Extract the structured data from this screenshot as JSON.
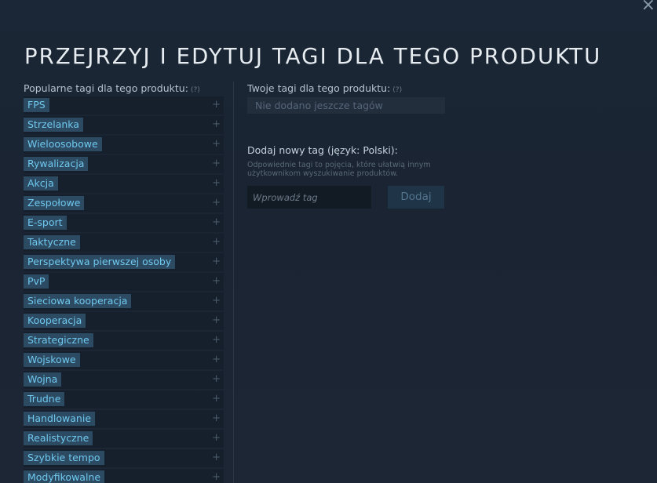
{
  "dialog": {
    "title": "PRZEJRZYJ I EDYTUJ TAGI DLA TEGO PRODUKTU",
    "close_glyph": "×"
  },
  "popular": {
    "heading": "Popularne tagi dla tego produktu:",
    "help": "(?)",
    "plus_glyph": "+",
    "tags": [
      "FPS",
      "Strzelanka",
      "Wieloosobowe",
      "Rywalizacja",
      "Akcja",
      "Zespołowe",
      "E-sport",
      "Taktyczne",
      "Perspektywa pierwszej osoby",
      "PvP",
      "Sieciowa kooperacja",
      "Kooperacja",
      "Strategiczne",
      "Wojskowe",
      "Wojna",
      "Trudne",
      "Handlowanie",
      "Realistyczne",
      "Szybkie tempo",
      "Modyfikowalne"
    ]
  },
  "yours": {
    "heading": "Twoje tagi dla tego produktu:",
    "help": "(?)",
    "empty_text": "Nie dodano jeszcze tagów"
  },
  "add_tag": {
    "heading": "Dodaj nowy tag (język: Polski):",
    "description": "Odpowiednie tagi to pojęcia, które ułatwią innym użytkownikom wyszukiwanie produktów.",
    "input_placeholder": "Wprowadź tag",
    "input_value": "",
    "button_label": "Dodaj"
  },
  "colors": {
    "tag_chip_bg": "#2c4a61",
    "tag_chip_text": "#6fc8ef",
    "background": "#1b2736"
  }
}
